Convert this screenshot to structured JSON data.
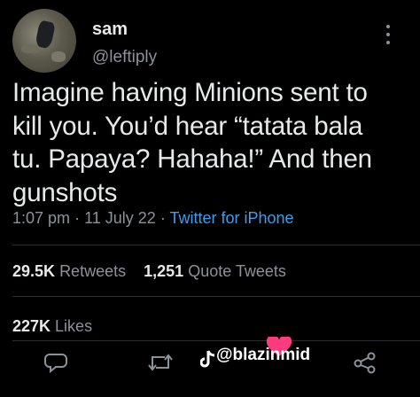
{
  "user": {
    "display_name": "sam",
    "handle": "@leftiply"
  },
  "tweet": {
    "text_lines": [
      "Imagine having Minions sent to",
      "kill you. You’d hear “tatata bala",
      "tu. Papaya? Hahaha!” And then",
      "gunshots"
    ],
    "time": "1:07 pm",
    "date": "11 July 22",
    "source": "Twitter for iPhone",
    "separator": "·"
  },
  "stats": {
    "retweets_count": "29.5K",
    "retweets_label": "Retweets",
    "quote_count": "1,251",
    "quote_label": "Quote Tweets",
    "likes_count": "227K",
    "likes_label": "Likes"
  },
  "watermark": {
    "text": "@blazinmid"
  },
  "icons": {
    "more": "more-vertical-icon",
    "reply": "reply-icon",
    "retweet": "retweet-icon",
    "tiktok": "tiktok-icon",
    "share": "share-icon",
    "heart": "heart-icon"
  },
  "colors": {
    "background": "#000000",
    "text": "#e7e9ea",
    "muted": "#8b9298",
    "link": "#3b9ef0",
    "heart": "#ff3b7f"
  }
}
